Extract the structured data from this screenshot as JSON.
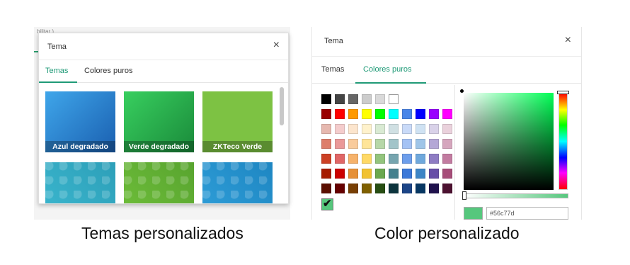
{
  "left_panel": {
    "background_text": "bilitar )",
    "title": "Tema",
    "close_glyph": "×",
    "tabs": [
      {
        "label": "Temas",
        "active": true
      },
      {
        "label": "Colores puros",
        "active": false
      }
    ],
    "themes": [
      {
        "label": "Azul degradado",
        "colors": [
          "#3fa6ea",
          "#1a5fb0"
        ]
      },
      {
        "label": "Verde degradado",
        "colors": [
          "#38cf5f",
          "#1a8a3a"
        ]
      },
      {
        "label": "ZKTeco Verde",
        "colors": [
          "#7dc243",
          "#7dc243"
        ]
      },
      {
        "label": "",
        "colors": [
          "#3bb7cf",
          "#2d9fb8"
        ]
      },
      {
        "label": "",
        "colors": [
          "#6fbf3a",
          "#58a42f"
        ]
      },
      {
        "label": "",
        "colors": [
          "#2f9fd9",
          "#1e86c2"
        ]
      }
    ]
  },
  "right_panel": {
    "title": "Tema",
    "close_glyph": "×",
    "tabs": [
      {
        "label": "Temas",
        "active": false
      },
      {
        "label": "Colores puros",
        "active": true
      }
    ],
    "swatch_rows": [
      [
        "#000000",
        "#444444",
        "#666666",
        "#cccccc",
        "#d9d9d9",
        "#ffffff"
      ],
      [
        "#990000",
        "#ff0000",
        "#ff9900",
        "#ffff00",
        "#00ff00",
        "#00ffff",
        "#4a86e8",
        "#0000ff",
        "#9900ff",
        "#ff00ff"
      ],
      [
        "#e6b8af",
        "#f4cccc",
        "#fce5cd",
        "#fff2cc",
        "#d9ead3",
        "#d0e0e3",
        "#c9daf8",
        "#cfe2f3",
        "#d9d2e9",
        "#ead1dc"
      ],
      [
        "#dd7e6b",
        "#ea9999",
        "#f9cb9c",
        "#ffe599",
        "#b6d7a8",
        "#a2c4c9",
        "#a4c2f4",
        "#9fc5e8",
        "#b4a7d6",
        "#d5a6bd"
      ],
      [
        "#cc4125",
        "#e06666",
        "#f6b26b",
        "#ffd966",
        "#93c47d",
        "#76a5af",
        "#6d9eeb",
        "#6fa8dc",
        "#8e7cc3",
        "#c27ba0"
      ],
      [
        "#a61c00",
        "#cc0000",
        "#e69138",
        "#f1c232",
        "#6aa84f",
        "#45818e",
        "#3c78d8",
        "#3d85c6",
        "#674ea7",
        "#a64d79"
      ],
      [
        "#5b0f00",
        "#660000",
        "#783f04",
        "#7f6000",
        "#274e13",
        "#0c343d",
        "#1c4587",
        "#073763",
        "#20124d",
        "#4c1130"
      ]
    ],
    "selected_color": "#56c77d",
    "hex_value": "#56c77d",
    "check_glyph": "✔"
  },
  "captions": {
    "left": "Temas personalizados",
    "right": "Color personalizado"
  }
}
